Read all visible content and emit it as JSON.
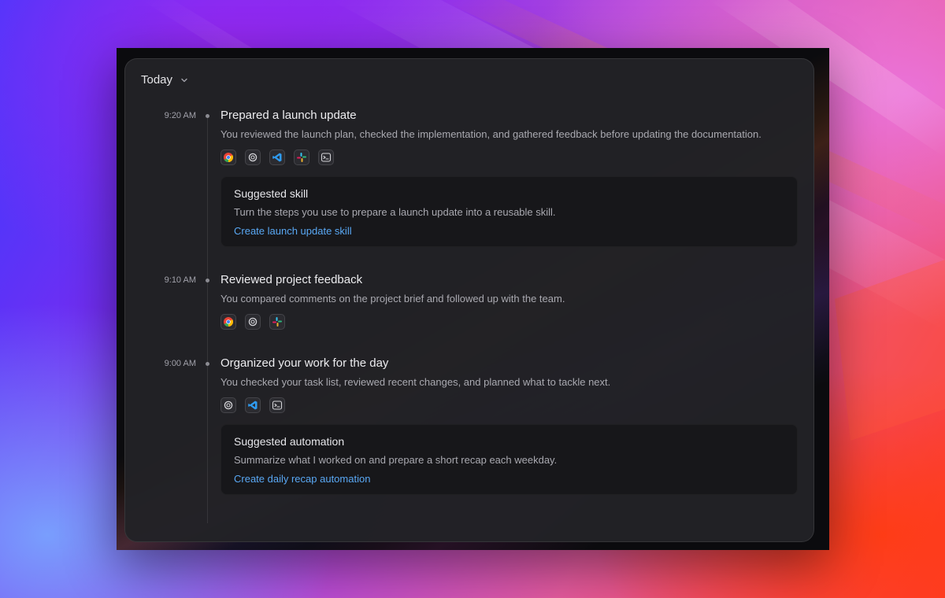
{
  "header": {
    "title": "Today"
  },
  "entries": [
    {
      "time": "9:20 AM",
      "title": "Prepared a launch update",
      "description": "You reviewed the launch plan, checked the implementation, and gathered feedback before updating the documentation.",
      "apps": [
        "chrome-icon",
        "chatgpt-icon",
        "vscode-icon",
        "slack-icon",
        "terminal-icon"
      ],
      "suggestion": {
        "title": "Suggested skill",
        "description": "Turn the steps you use to prepare a launch update into a reusable skill.",
        "link": "Create launch update skill"
      }
    },
    {
      "time": "9:10 AM",
      "title": "Reviewed project feedback",
      "description": "You compared comments on the project brief and followed up with the team.",
      "apps": [
        "chrome-icon",
        "chatgpt-icon",
        "slack-icon"
      ]
    },
    {
      "time": "9:00 AM",
      "title": "Organized your work for the day",
      "description": "You checked your task list, reviewed recent changes, and planned what to tackle next.",
      "apps": [
        "chatgpt-icon",
        "vscode-icon",
        "terminal-icon"
      ],
      "suggestion": {
        "title": "Suggested automation",
        "description": "Summarize what I worked on and prepare a short recap each weekday.",
        "link": "Create daily recap automation"
      }
    }
  ],
  "colors": {
    "panel": "#222226",
    "card": "#17171a",
    "link": "#59a8f4",
    "text_primary": "#ececef",
    "text_secondary": "#a9a9b0"
  }
}
